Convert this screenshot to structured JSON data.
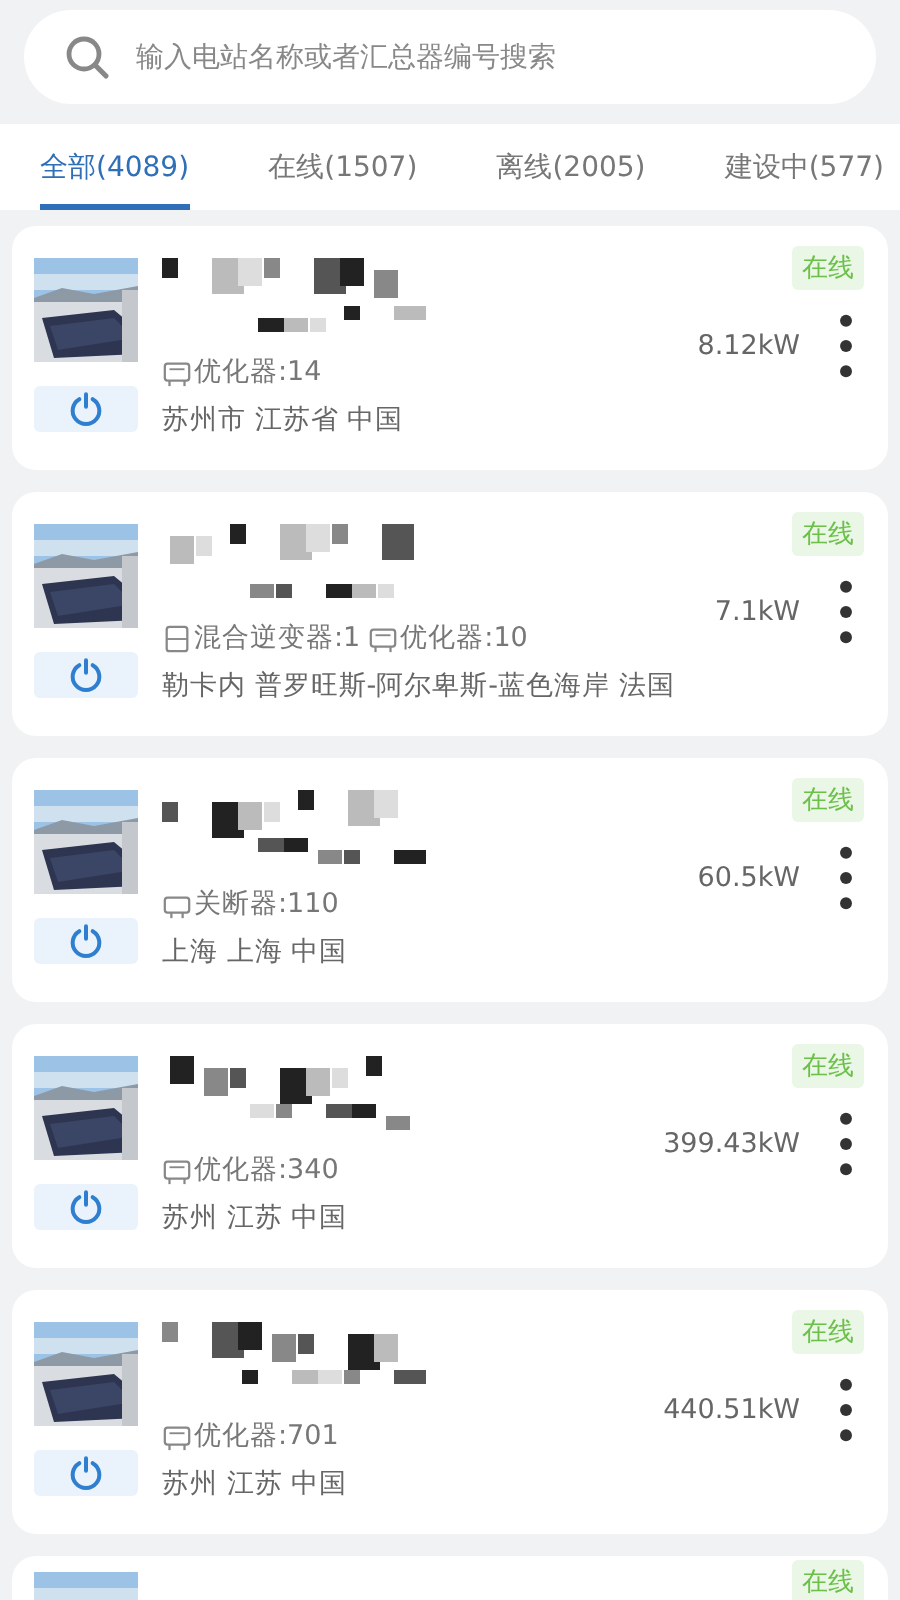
{
  "search": {
    "placeholder": "输入电站名称或者汇总器编号搜索"
  },
  "tabs": [
    {
      "label": "全部(4089)",
      "selected": true
    },
    {
      "label": "在线(1507)",
      "selected": false
    },
    {
      "label": "离线(2005)",
      "selected": false
    },
    {
      "label": "建设中(577)",
      "selected": false
    }
  ],
  "stations": [
    {
      "status": "在线",
      "online": true,
      "devices": [
        {
          "kind": "optimizer",
          "label": "优化器:14"
        }
      ],
      "power": "8.12kW",
      "location": "苏州市 江苏省 中国"
    },
    {
      "status": "在线",
      "online": true,
      "devices": [
        {
          "kind": "hybrid",
          "label": "混合逆变器:1"
        },
        {
          "kind": "optimizer",
          "label": "优化器:10"
        }
      ],
      "power": "7.1kW",
      "location": "勒卡内 普罗旺斯-阿尔卑斯-蓝色海岸 法国"
    },
    {
      "status": "在线",
      "online": true,
      "devices": [
        {
          "kind": "breaker",
          "label": "关断器:110"
        }
      ],
      "power": "60.5kW",
      "location": "上海 上海 中国"
    },
    {
      "status": "在线",
      "online": true,
      "devices": [
        {
          "kind": "optimizer",
          "label": "优化器:340"
        }
      ],
      "power": "399.43kW",
      "location": "苏州 江苏 中国"
    },
    {
      "status": "在线",
      "online": true,
      "devices": [
        {
          "kind": "optimizer",
          "label": "优化器:701"
        }
      ],
      "power": "440.51kW",
      "location": "苏州 江苏 中国"
    },
    {
      "status": "在线",
      "online": true
    }
  ]
}
